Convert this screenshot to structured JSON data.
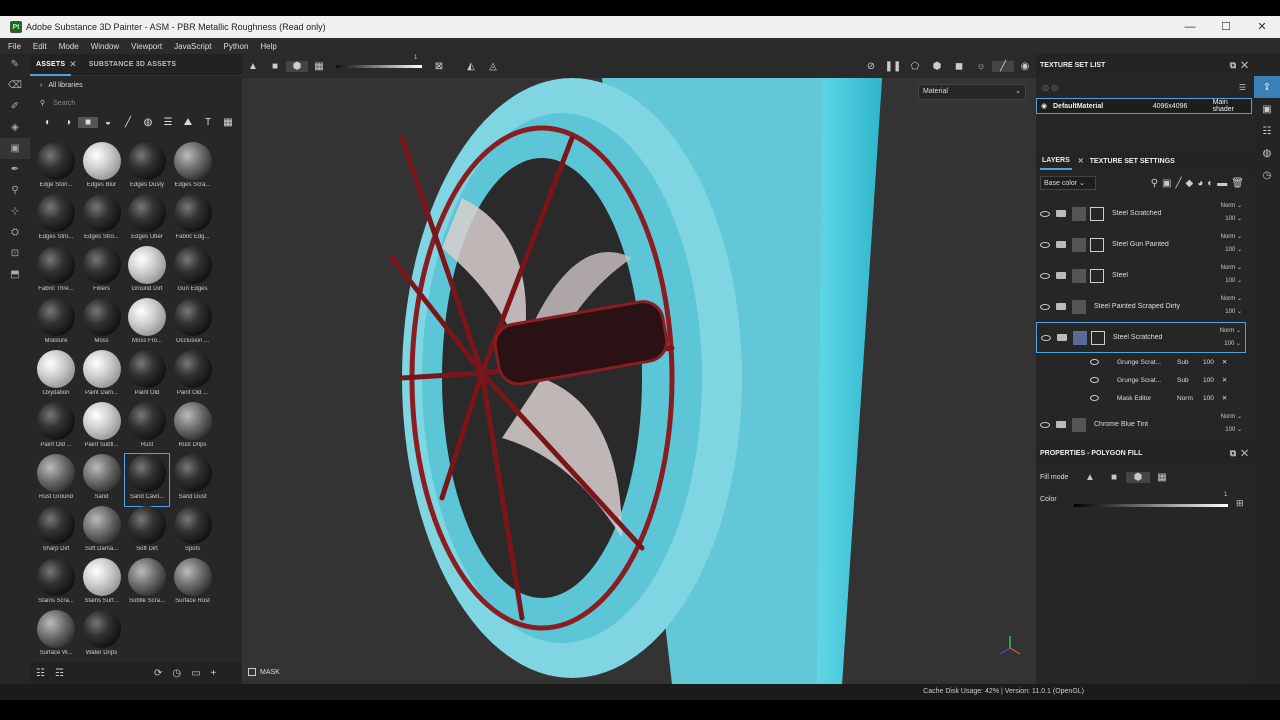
{
  "window": {
    "title": "Adobe Substance 3D Painter - ASM - PBR Metallic Roughness (Read only)",
    "app_badge": "Pt"
  },
  "menu": [
    "File",
    "Edit",
    "Mode",
    "Window",
    "Viewport",
    "JavaScript",
    "Python",
    "Help"
  ],
  "assets": {
    "tabs": [
      "ASSETS",
      "SUBSTANCE 3D ASSETS"
    ],
    "all_libraries": "All libraries",
    "search_placeholder": "Search",
    "items": [
      {
        "label": "Edge Ston...",
        "tone": "dark"
      },
      {
        "label": "Edges Blur",
        "tone": "light"
      },
      {
        "label": "Edges Dusty",
        "tone": "dark"
      },
      {
        "label": "Edges Scra...",
        "tone": "mid"
      },
      {
        "label": "Edges Stro...",
        "tone": "dark"
      },
      {
        "label": "Edges Stro...",
        "tone": "dark"
      },
      {
        "label": "Edges Uber",
        "tone": "dark"
      },
      {
        "label": "Fabric Edg...",
        "tone": "dark"
      },
      {
        "label": "Fabric Thre...",
        "tone": "dark"
      },
      {
        "label": "Fibers",
        "tone": "dark"
      },
      {
        "label": "Ground Dirt",
        "tone": "light"
      },
      {
        "label": "Gun Edges",
        "tone": "dark"
      },
      {
        "label": "Moisture",
        "tone": "dark"
      },
      {
        "label": "Moss",
        "tone": "dark"
      },
      {
        "label": "Moss Fro...",
        "tone": "light"
      },
      {
        "label": "Occlusion ...",
        "tone": "dark"
      },
      {
        "label": "Oxydation",
        "tone": "light"
      },
      {
        "label": "Paint Dam...",
        "tone": "light"
      },
      {
        "label": "Paint Old",
        "tone": "dark"
      },
      {
        "label": "Paint Old ...",
        "tone": "dark"
      },
      {
        "label": "Paint Old ...",
        "tone": "dark"
      },
      {
        "label": "Paint Subtl...",
        "tone": "light"
      },
      {
        "label": "Rust",
        "tone": "dark"
      },
      {
        "label": "Rust Drips",
        "tone": "mid"
      },
      {
        "label": "Rust Ground",
        "tone": "mid"
      },
      {
        "label": "Sand",
        "tone": "mid"
      },
      {
        "label": "Sand Cavit...",
        "tone": "dark",
        "selected": true
      },
      {
        "label": "Sand Dust",
        "tone": "dark"
      },
      {
        "label": "Sharp Dirt",
        "tone": "dark"
      },
      {
        "label": "Soft Dama...",
        "tone": "mid"
      },
      {
        "label": "Soft Dirt",
        "tone": "dark"
      },
      {
        "label": "Spots",
        "tone": "dark"
      },
      {
        "label": "Stains Scra...",
        "tone": "dark"
      },
      {
        "label": "Stains Surf...",
        "tone": "light"
      },
      {
        "label": "Subtle Scra...",
        "tone": "mid"
      },
      {
        "label": "Surface Rust",
        "tone": "mid"
      },
      {
        "label": "Surface W...",
        "tone": "mid"
      },
      {
        "label": "Water Drips",
        "tone": "dark"
      }
    ]
  },
  "viewport": {
    "material_mode": "Material",
    "brush_value": "1",
    "mask_label": "MASK"
  },
  "texture_set_list": {
    "title": "TEXTURE SET LIST",
    "row": {
      "name": "DefaultMaterial",
      "resolution": "4096x4096",
      "shader": "Main shader"
    }
  },
  "layers": {
    "tabs": [
      "LAYERS",
      "TEXTURE SET SETTINGS"
    ],
    "channel": "Base color",
    "items": [
      {
        "name": "Steel Scratched",
        "blend": "Norm",
        "opacity": "100",
        "mask": true
      },
      {
        "name": "Steel Gun Painted",
        "blend": "Norm",
        "opacity": "100",
        "mask": true
      },
      {
        "name": "Steel",
        "blend": "Norm",
        "opacity": "100",
        "mask": true
      },
      {
        "name": "Steel Painted Scraped Dirty",
        "blend": "Norm",
        "opacity": "100",
        "mask": false
      },
      {
        "name": "Steel Scratched",
        "blend": "Norm",
        "opacity": "100",
        "mask": true,
        "selected": true
      },
      {
        "name": "Chrome Blue Tint",
        "blend": "Norm",
        "opacity": "100",
        "mask": false
      }
    ],
    "sub_items": [
      {
        "name": "Grunge Scrat...",
        "blend": "Sub",
        "opacity": "100"
      },
      {
        "name": "Grunge Scrat...",
        "blend": "Sub",
        "opacity": "100"
      },
      {
        "name": "Mask Editor",
        "blend": "Norm",
        "opacity": "100"
      }
    ]
  },
  "properties": {
    "title": "PROPERTIES - POLYGON FILL",
    "fill_mode_label": "Fill mode",
    "color_label": "Color",
    "color_value": "1"
  },
  "status": {
    "text": "Cache Disk Usage:   42% | Version: 11.0.1 (OpenGL)"
  }
}
